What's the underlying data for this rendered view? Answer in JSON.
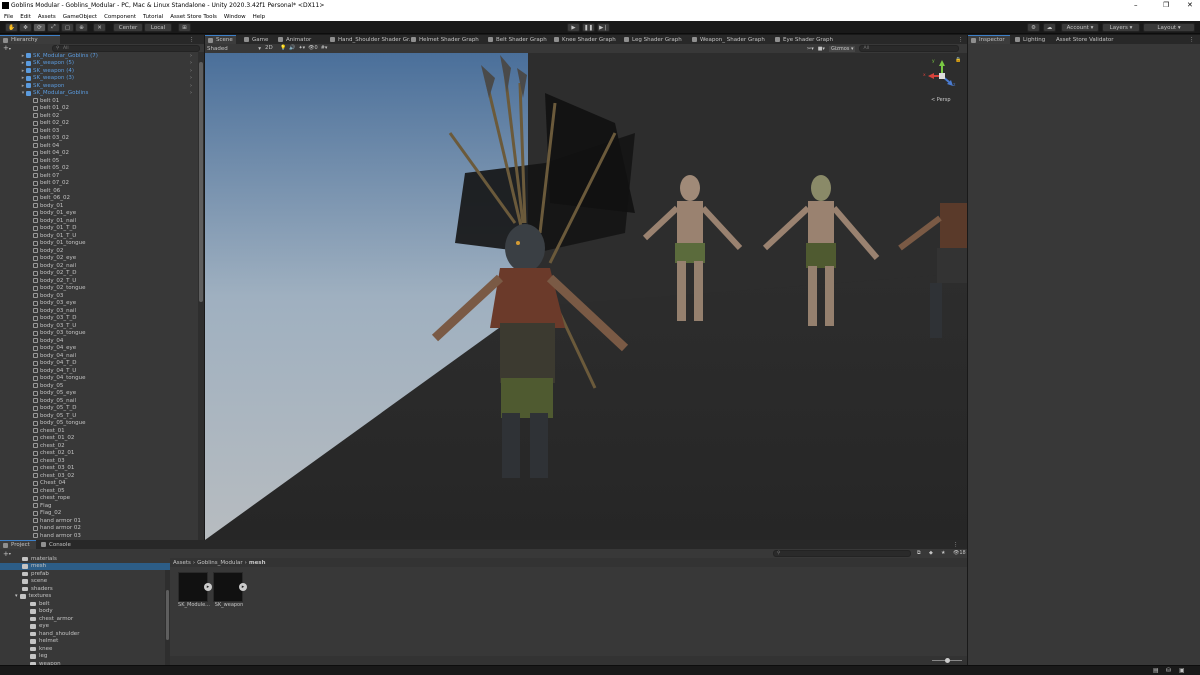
{
  "window": {
    "title": "Goblins Modular - Goblins_Modular - PC, Mac & Linux Standalone - Unity 2020.3.42f1 Personal* <DX11>",
    "controls": [
      "–",
      "❐",
      "✕"
    ]
  },
  "menu": [
    "File",
    "Edit",
    "Assets",
    "GameObject",
    "Component",
    "Tutorial",
    "Asset Store Tools",
    "Window",
    "Help"
  ],
  "toolbar": {
    "pivot": "Center",
    "space": "Local",
    "account": "Account",
    "layers": "Layers",
    "layout": "Layout"
  },
  "hierarchy": {
    "tab": "Hierarchy",
    "search_placeholder": "All",
    "items": [
      {
        "label": "SK_Modular_Goblins (7)",
        "prefab": true,
        "arrow": "▸",
        "sub": "›"
      },
      {
        "label": "SK_weapon (5)",
        "prefab": true,
        "arrow": "▸",
        "sub": "›"
      },
      {
        "label": "SK_weapon (4)",
        "prefab": true,
        "arrow": "▸",
        "sub": "›"
      },
      {
        "label": "SK_weapon (3)",
        "prefab": true,
        "arrow": "▸",
        "sub": "›"
      },
      {
        "label": "SK_weapon",
        "prefab": true,
        "arrow": "▸",
        "sub": "›"
      },
      {
        "label": "SK_Modular_Goblins",
        "prefab": true,
        "arrow": "▾",
        "sub": "›"
      },
      {
        "label": "belt 01"
      },
      {
        "label": "belt 01_02"
      },
      {
        "label": "belt 02"
      },
      {
        "label": "belt 02_02"
      },
      {
        "label": "belt 03"
      },
      {
        "label": "belt 03_02"
      },
      {
        "label": "belt 04"
      },
      {
        "label": "belt 04_02"
      },
      {
        "label": "belt 05"
      },
      {
        "label": "belt 05_02"
      },
      {
        "label": "belt 07"
      },
      {
        "label": "belt 07_02"
      },
      {
        "label": "belt_06"
      },
      {
        "label": "belt_06_02"
      },
      {
        "label": "body_01"
      },
      {
        "label": "body_01_eye"
      },
      {
        "label": "body_01_nail"
      },
      {
        "label": "body_01_T_D"
      },
      {
        "label": "body_01_T_U"
      },
      {
        "label": "body_01_tongue"
      },
      {
        "label": "body_02"
      },
      {
        "label": "body_02_eye"
      },
      {
        "label": "body_02_nail"
      },
      {
        "label": "body_02_T_D"
      },
      {
        "label": "body_02_T_U"
      },
      {
        "label": "body_02_tongue"
      },
      {
        "label": "body_03"
      },
      {
        "label": "body_03_eye"
      },
      {
        "label": "body_03_nail"
      },
      {
        "label": "body_03_T_D"
      },
      {
        "label": "body_03_T_U"
      },
      {
        "label": "body_03_tongue"
      },
      {
        "label": "body_04"
      },
      {
        "label": "body_04_eye"
      },
      {
        "label": "body_04_nail"
      },
      {
        "label": "body_04_T_D"
      },
      {
        "label": "body_04_T_U"
      },
      {
        "label": "body_04_tongue"
      },
      {
        "label": "body_05"
      },
      {
        "label": "body_05_eye"
      },
      {
        "label": "body_05_nail"
      },
      {
        "label": "body_05_T_D"
      },
      {
        "label": "body_05_T_U"
      },
      {
        "label": "body_05_tongue"
      },
      {
        "label": "chest_01"
      },
      {
        "label": "chest_01_02"
      },
      {
        "label": "chest_02"
      },
      {
        "label": "chest_02_01"
      },
      {
        "label": "chest_03"
      },
      {
        "label": "chest_03_01"
      },
      {
        "label": "chest_03_02"
      },
      {
        "label": "Chest_04"
      },
      {
        "label": "chest_05"
      },
      {
        "label": "chest_rope"
      },
      {
        "label": "Flag"
      },
      {
        "label": "Flag_02"
      },
      {
        "label": "hand armor 01"
      },
      {
        "label": "hand armor 02"
      },
      {
        "label": "hand armor 03"
      }
    ]
  },
  "scene": {
    "tabs": [
      "Scene",
      "Game",
      "Animator",
      "Hand_Shoulder Shader Gr...",
      "Helmet Shader Graph",
      "Belt Shader Graph",
      "Knee Shader Graph",
      "Leg Shader Graph",
      "Weapon_ Shader Graph",
      "Eye Shader Graph"
    ],
    "shading": "Shaded",
    "mode2d": "2D",
    "gizmos": "Gizmos",
    "search_placeholder": "All",
    "persp": "< Persp",
    "axis": {
      "x": "x",
      "y": "y",
      "z": "z"
    }
  },
  "inspector": {
    "tabs": [
      "Inspector",
      "Lighting",
      "Asset Store Validator"
    ]
  },
  "project": {
    "tabs": [
      "Project",
      "Console"
    ],
    "tree": [
      {
        "label": "materials",
        "indent": 1
      },
      {
        "label": "mesh",
        "indent": 1,
        "selected": true
      },
      {
        "label": "prefab",
        "indent": 1
      },
      {
        "label": "scene",
        "indent": 1
      },
      {
        "label": "shaders",
        "indent": 1
      },
      {
        "label": "textures",
        "indent": 1,
        "open": true
      },
      {
        "label": "belt",
        "indent": 2
      },
      {
        "label": "body",
        "indent": 2
      },
      {
        "label": "chest_armor",
        "indent": 2
      },
      {
        "label": "eye",
        "indent": 2
      },
      {
        "label": "hand_shoulder",
        "indent": 2
      },
      {
        "label": "helmet",
        "indent": 2
      },
      {
        "label": "knee",
        "indent": 2
      },
      {
        "label": "leg",
        "indent": 2
      },
      {
        "label": "weapon",
        "indent": 2
      }
    ],
    "breadcrumb": [
      "Assets",
      "Goblins_Modular",
      "mesh"
    ],
    "assets": [
      {
        "label": "SK_Module..."
      },
      {
        "label": "SK_weapon"
      }
    ],
    "badge": "18"
  },
  "colors": {
    "accent": "#3d7fc7",
    "prefab_text": "#5b9bde",
    "panel": "#383838",
    "dark": "#191919"
  }
}
